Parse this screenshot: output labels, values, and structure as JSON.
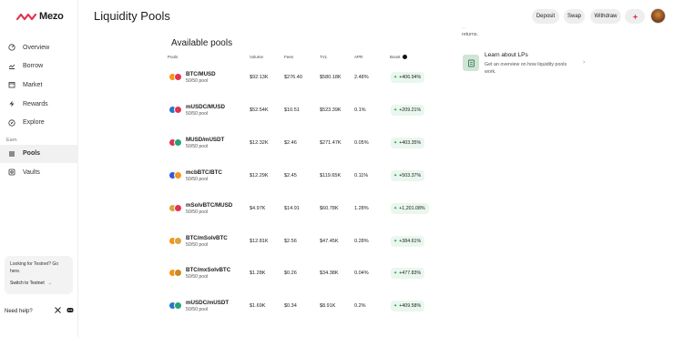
{
  "app": {
    "name": "Mezo",
    "brand_color": "#e1334f"
  },
  "header": {
    "title": "Liquidity Pools",
    "buttons": {
      "deposit": "Deposit",
      "swap": "Swap",
      "withdraw": "Withdraw"
    }
  },
  "sidebar": {
    "items": [
      {
        "label": "Overview",
        "icon": "overview-icon"
      },
      {
        "label": "Borrow",
        "icon": "borrow-icon"
      },
      {
        "label": "Market",
        "icon": "market-icon"
      },
      {
        "label": "Rewards",
        "icon": "rewards-icon"
      },
      {
        "label": "Explore",
        "icon": "explore-icon"
      }
    ],
    "earn_section": "Earn",
    "earn_items": [
      {
        "label": "Pools",
        "icon": "pools-icon",
        "active": true
      },
      {
        "label": "Vaults",
        "icon": "vaults-icon"
      }
    ],
    "testnet_card": {
      "question": "Looking for Testnet? Go here.",
      "link": "Switch to Testnet"
    },
    "help": "Need help?"
  },
  "pools": {
    "title": "Available pools",
    "columns": [
      "Pools",
      "Volume",
      "Fees",
      "TVL",
      "APR",
      "Boost"
    ],
    "rows": [
      {
        "name": "BTC/MUSD",
        "sub": "50/50 pool",
        "volume": "$92.13K",
        "fees": "$276.40",
        "tvl": "$580.18K",
        "apr": "2.48%",
        "boost": "+406.94%",
        "c1": "#f7931a",
        "c2": "#e1334f"
      },
      {
        "name": "mUSDC/MUSD",
        "sub": "50/50 pool",
        "volume": "$52.54K",
        "fees": "$10.51",
        "tvl": "$523.39K",
        "apr": "0.1%",
        "boost": "+209.21%",
        "c1": "#2775ca",
        "c2": "#e1334f"
      },
      {
        "name": "MUSD/mUSDT",
        "sub": "50/50 pool",
        "volume": "$12.32K",
        "fees": "$2.46",
        "tvl": "$271.47K",
        "apr": "0.05%",
        "boost": "+403.35%",
        "c1": "#e1334f",
        "c2": "#26a17b"
      },
      {
        "name": "mcbBTC/BTC",
        "sub": "50/50 pool",
        "volume": "$12.29K",
        "fees": "$2.45",
        "tvl": "$119.65K",
        "apr": "0.11%",
        "boost": "+503.37%",
        "c1": "#2a5ada",
        "c2": "#f7931a"
      },
      {
        "name": "mSolvBTC/MUSD",
        "sub": "50/50 pool",
        "volume": "$4.97K",
        "fees": "$14.91",
        "tvl": "$60.78K",
        "apr": "1.28%",
        "boost": "+1,201.08%",
        "c1": "#d9a441",
        "c2": "#e1334f"
      },
      {
        "name": "BTC/mSolvBTC",
        "sub": "50/50 pool",
        "volume": "$12.81K",
        "fees": "$2.56",
        "tvl": "$47.45K",
        "apr": "0.28%",
        "boost": "+384.61%",
        "c1": "#f7931a",
        "c2": "#d9a441"
      },
      {
        "name": "BTC/mxSolvBTC",
        "sub": "50/50 pool",
        "volume": "$1.28K",
        "fees": "$0.26",
        "tvl": "$34.38K",
        "apr": "0.04%",
        "boost": "+477.83%",
        "c1": "#f7931a",
        "c2": "#c98a1e"
      },
      {
        "name": "mUSDC/mUSDT",
        "sub": "50/50 pool",
        "volume": "$1.69K",
        "fees": "$0.34",
        "tvl": "$8.91K",
        "apr": "0.2%",
        "boost": "+409.58%",
        "c1": "#2775ca",
        "c2": "#26a17b"
      }
    ]
  },
  "right_panel": {
    "cut_line1": "…",
    "cut_line2": "returns.",
    "learn_title": "Learn about LPs",
    "learn_desc": "Get an overview on how liquidity pools work."
  }
}
